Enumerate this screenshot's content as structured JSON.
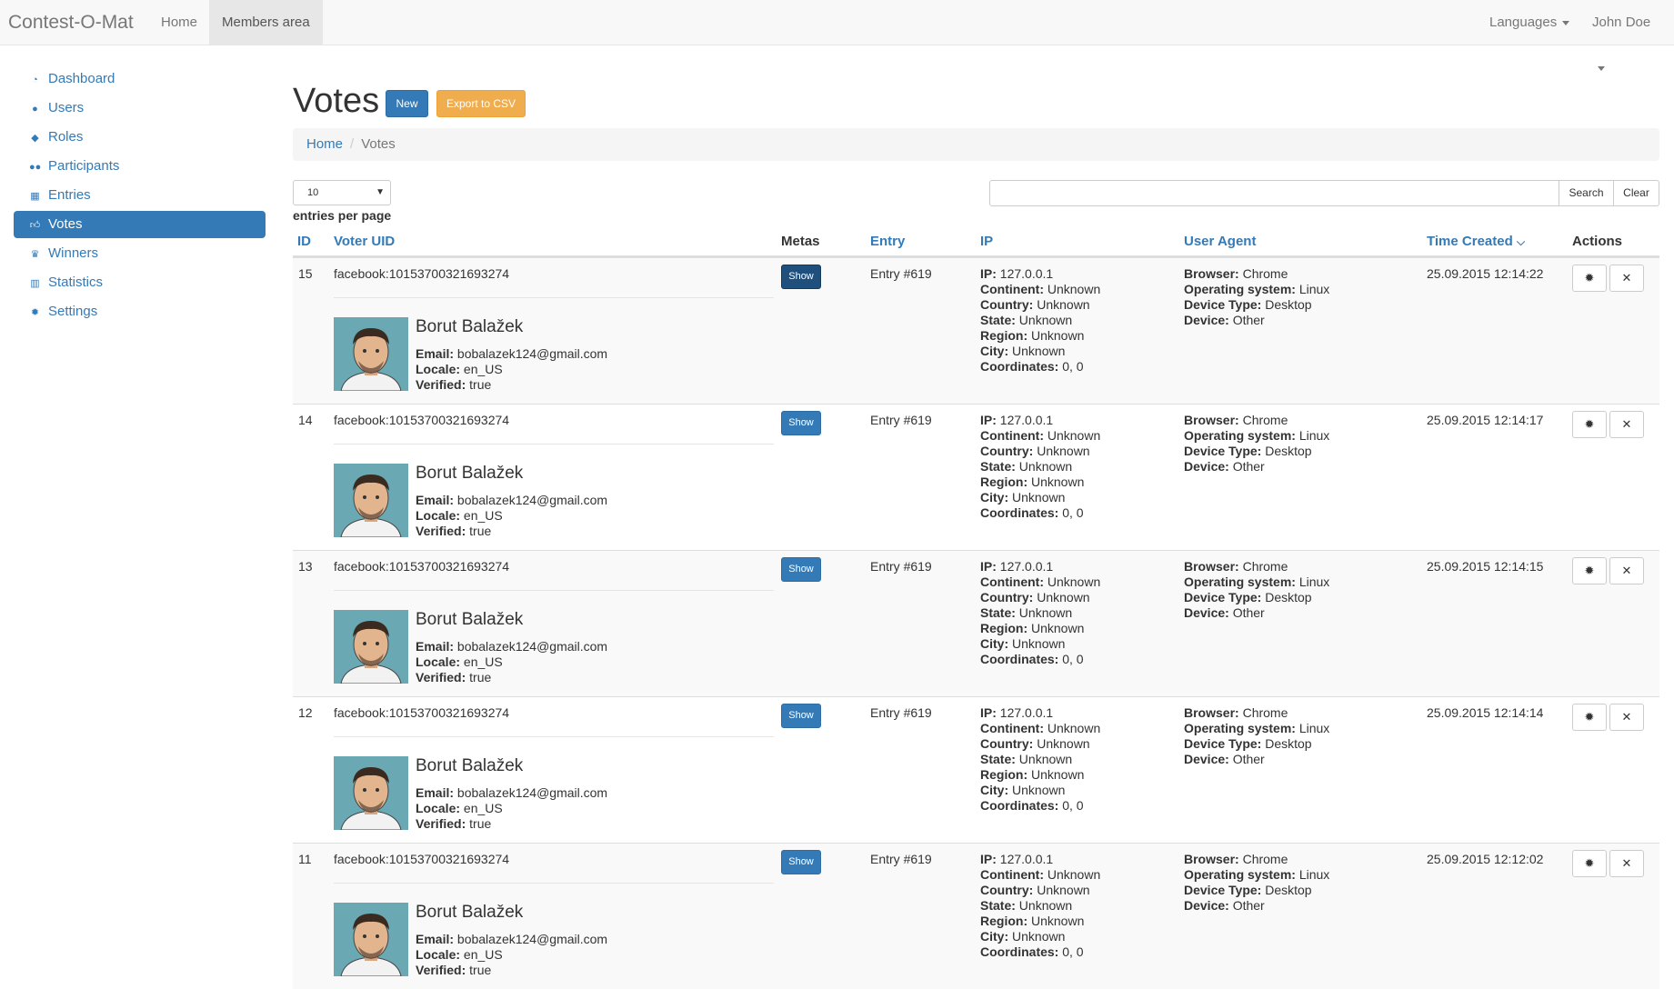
{
  "navbar": {
    "brand": "Contest-O-Mat",
    "links": [
      "Home",
      "Members area"
    ],
    "languages": "Languages",
    "user": "John Doe"
  },
  "sidebar": {
    "items": [
      {
        "label": "Dashboard",
        "icon": "dashboard-icon"
      },
      {
        "label": "Users",
        "icon": "user-icon"
      },
      {
        "label": "Roles",
        "icon": "tags-icon"
      },
      {
        "label": "Participants",
        "icon": "group-icon"
      },
      {
        "label": "Entries",
        "icon": "table-icon"
      },
      {
        "label": "Votes",
        "icon": "thumbs-up-icon"
      },
      {
        "label": "Winners",
        "icon": "trophy-icon"
      },
      {
        "label": "Statistics",
        "icon": "bar-chart-icon"
      },
      {
        "label": "Settings",
        "icon": "gear-icon"
      }
    ],
    "active": "Votes"
  },
  "page": {
    "title": "Votes",
    "new_label": "New",
    "export_label": "Export to CSV"
  },
  "breadcrumb": {
    "home": "Home",
    "current": "Votes"
  },
  "controls": {
    "per_page_value": "10",
    "per_page_label": "entries per page",
    "search_placeholder": "",
    "search_label": "Search",
    "clear_label": "Clear"
  },
  "table": {
    "headers": {
      "id": "ID",
      "voter_uid": "Voter UID",
      "metas": "Metas",
      "entry": "Entry",
      "ip": "IP",
      "user_agent": "User Agent",
      "time_created": "Time Created",
      "actions": "Actions"
    },
    "sort_indicator": "chevron-down-icon",
    "show_label": "Show",
    "labels": {
      "ip": "IP:",
      "continent": "Continent:",
      "country": "Country:",
      "state": "State:",
      "region": "Region:",
      "city": "City:",
      "coordinates": "Coordinates:",
      "browser": "Browser:",
      "os": "Operating system:",
      "device_type": "Device Type:",
      "device": "Device:",
      "email": "Email:",
      "locale": "Locale:",
      "verified": "Verified:"
    },
    "rows": [
      {
        "id": "15",
        "uid": "facebook:10153700321693274",
        "name": "Borut Balažek",
        "email": "bobalazek124@gmail.com",
        "locale": "en_US",
        "verified": "true",
        "entry": "Entry #619",
        "ip": "127.0.0.1",
        "continent": "Unknown",
        "country": "Unknown",
        "state": "Unknown",
        "region": "Unknown",
        "city": "Unknown",
        "coordinates": "0, 0",
        "browser": "Chrome",
        "os": "Linux",
        "device_type": "Desktop",
        "device": "Other",
        "time": "25.09.2015 12:14:22"
      },
      {
        "id": "14",
        "uid": "facebook:10153700321693274",
        "name": "Borut Balažek",
        "email": "bobalazek124@gmail.com",
        "locale": "en_US",
        "verified": "true",
        "entry": "Entry #619",
        "ip": "127.0.0.1",
        "continent": "Unknown",
        "country": "Unknown",
        "state": "Unknown",
        "region": "Unknown",
        "city": "Unknown",
        "coordinates": "0, 0",
        "browser": "Chrome",
        "os": "Linux",
        "device_type": "Desktop",
        "device": "Other",
        "time": "25.09.2015 12:14:17"
      },
      {
        "id": "13",
        "uid": "facebook:10153700321693274",
        "name": "Borut Balažek",
        "email": "bobalazek124@gmail.com",
        "locale": "en_US",
        "verified": "true",
        "entry": "Entry #619",
        "ip": "127.0.0.1",
        "continent": "Unknown",
        "country": "Unknown",
        "state": "Unknown",
        "region": "Unknown",
        "city": "Unknown",
        "coordinates": "0, 0",
        "browser": "Chrome",
        "os": "Linux",
        "device_type": "Desktop",
        "device": "Other",
        "time": "25.09.2015 12:14:15"
      },
      {
        "id": "12",
        "uid": "facebook:10153700321693274",
        "name": "Borut Balažek",
        "email": "bobalazek124@gmail.com",
        "locale": "en_US",
        "verified": "true",
        "entry": "Entry #619",
        "ip": "127.0.0.1",
        "continent": "Unknown",
        "country": "Unknown",
        "state": "Unknown",
        "region": "Unknown",
        "city": "Unknown",
        "coordinates": "0, 0",
        "browser": "Chrome",
        "os": "Linux",
        "device_type": "Desktop",
        "device": "Other",
        "time": "25.09.2015 12:14:14"
      },
      {
        "id": "11",
        "uid": "facebook:10153700321693274",
        "name": "Borut Balažek",
        "email": "bobalazek124@gmail.com",
        "locale": "en_US",
        "verified": "true",
        "entry": "Entry #619",
        "ip": "127.0.0.1",
        "continent": "Unknown",
        "country": "Unknown",
        "state": "Unknown",
        "region": "Unknown",
        "city": "Unknown",
        "coordinates": "0, 0",
        "browser": "Chrome",
        "os": "Linux",
        "device_type": "Desktop",
        "device": "Other",
        "time": "25.09.2015 12:12:02"
      }
    ]
  },
  "colors": {
    "primary": "#337ab7",
    "warning": "#f0ad4e",
    "active_show": "#1f4f7c"
  }
}
